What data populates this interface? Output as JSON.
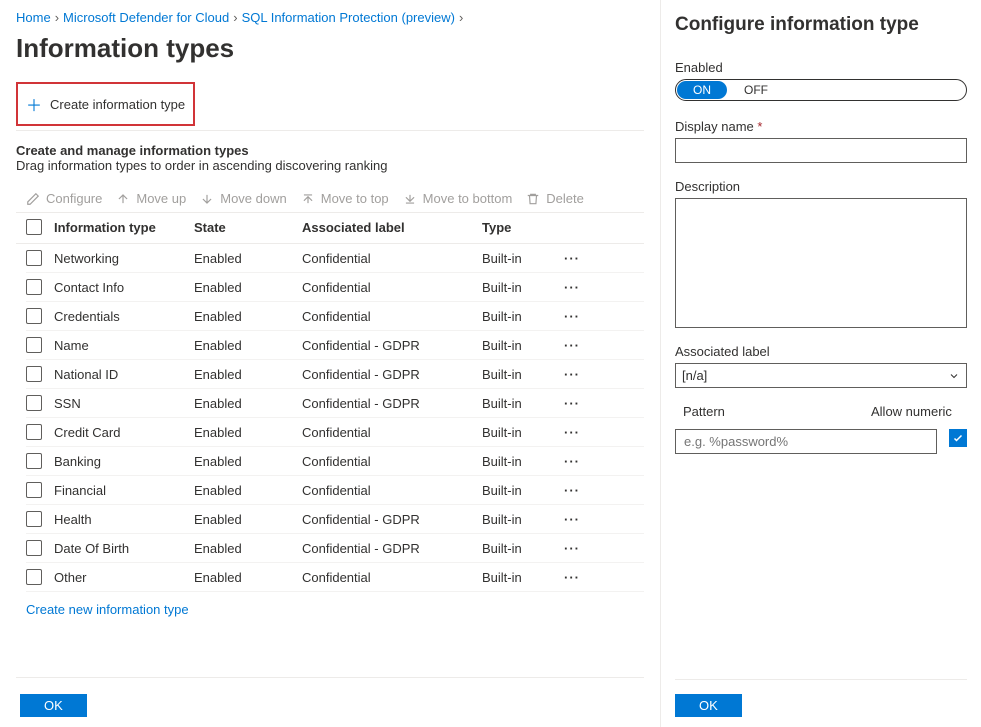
{
  "breadcrumb": {
    "items": [
      "Home",
      "Microsoft Defender for Cloud",
      "SQL Information Protection (preview)"
    ]
  },
  "page_title": "Information types",
  "commands": {
    "create": "Create information type"
  },
  "section": {
    "title": "Create and manage information types",
    "subtitle": "Drag information types to order in ascending discovering ranking"
  },
  "toolbar": {
    "configure": "Configure",
    "move_up": "Move up",
    "move_down": "Move down",
    "move_top": "Move to top",
    "move_bottom": "Move to bottom",
    "delete": "Delete"
  },
  "columns": {
    "name": "Information type",
    "state": "State",
    "label": "Associated label",
    "type": "Type"
  },
  "rows": [
    {
      "name": "Networking",
      "state": "Enabled",
      "label": "Confidential",
      "type": "Built-in"
    },
    {
      "name": "Contact Info",
      "state": "Enabled",
      "label": "Confidential",
      "type": "Built-in"
    },
    {
      "name": "Credentials",
      "state": "Enabled",
      "label": "Confidential",
      "type": "Built-in"
    },
    {
      "name": "Name",
      "state": "Enabled",
      "label": "Confidential - GDPR",
      "type": "Built-in"
    },
    {
      "name": "National ID",
      "state": "Enabled",
      "label": "Confidential - GDPR",
      "type": "Built-in"
    },
    {
      "name": "SSN",
      "state": "Enabled",
      "label": "Confidential - GDPR",
      "type": "Built-in"
    },
    {
      "name": "Credit Card",
      "state": "Enabled",
      "label": "Confidential",
      "type": "Built-in"
    },
    {
      "name": "Banking",
      "state": "Enabled",
      "label": "Confidential",
      "type": "Built-in"
    },
    {
      "name": "Financial",
      "state": "Enabled",
      "label": "Confidential",
      "type": "Built-in"
    },
    {
      "name": "Health",
      "state": "Enabled",
      "label": "Confidential - GDPR",
      "type": "Built-in"
    },
    {
      "name": "Date Of Birth",
      "state": "Enabled",
      "label": "Confidential - GDPR",
      "type": "Built-in"
    },
    {
      "name": "Other",
      "state": "Enabled",
      "label": "Confidential",
      "type": "Built-in"
    }
  ],
  "footer_link": "Create new information type",
  "ok_label": "OK",
  "panel": {
    "title": "Configure information type",
    "enabled_label": "Enabled",
    "toggle_on": "ON",
    "toggle_off": "OFF",
    "display_name_label": "Display name",
    "description_label": "Description",
    "associated_label": "Associated label",
    "associated_value": "[n/a]",
    "pattern_label": "Pattern",
    "allow_numeric_label": "Allow numeric",
    "pattern_placeholder": "e.g. %password%",
    "ok_label": "OK"
  }
}
